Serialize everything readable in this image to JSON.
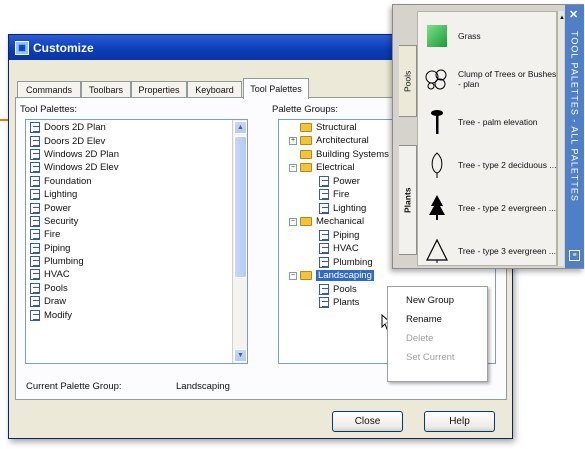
{
  "dialog": {
    "title": "Customize",
    "tabs": [
      "Commands",
      "Toolbars",
      "Properties",
      "Keyboard",
      "Tool Palettes"
    ],
    "active_tab": "Tool Palettes",
    "tool_palettes_label": "Tool Palettes:",
    "tool_palettes": [
      "Doors 2D Plan",
      "Doors 2D Elev",
      "Windows 2D Plan",
      "Windows 2D Elev",
      "Foundation",
      "Lighting",
      "Power",
      "Security",
      "Fire",
      "Piping",
      "Plumbing",
      "HVAC",
      "Pools",
      "Draw",
      "Modify"
    ],
    "palette_groups_label": "Palette Groups:",
    "groups": {
      "structural": "Structural",
      "architectural": "Architectural",
      "building_systems": "Building Systems",
      "electrical": "Electrical",
      "power": "Power",
      "fire": "Fire",
      "lighting": "Lighting",
      "mechanical": "Mechanical",
      "piping": "Piping",
      "hvac": "HVAC",
      "plumbing": "Plumbing",
      "landscaping": "Landscaping",
      "pools": "Pools",
      "plants": "Plants"
    },
    "current_group_label": "Current Palette Group:",
    "current_group_value": "Landscaping",
    "close_label": "Close",
    "help_label": "Help"
  },
  "context_menu": {
    "new_group": "New Group",
    "rename": "Rename",
    "delete": "Delete",
    "set_current": "Set Current"
  },
  "palette_window": {
    "side_title": "TOOL PALETTES - ALL PALETTES",
    "tab_pools": "Pools",
    "tab_plants": "Plants",
    "items": [
      {
        "label": "Grass",
        "icon": "grass-swatch-icon"
      },
      {
        "label": "Clump of Trees or Bushes - plan",
        "icon": "tree-clump-icon"
      },
      {
        "label": "Tree - palm elevation",
        "icon": "palm-tree-icon"
      },
      {
        "label": "Tree - type 2 deciduous ...",
        "icon": "deciduous-tree-icon"
      },
      {
        "label": "Tree - type 2 evergreen ...",
        "icon": "evergreen-tree-icon"
      },
      {
        "label": "Tree - type 3 evergreen ...",
        "icon": "triangle-tree-icon"
      }
    ]
  },
  "colors": {
    "title_bar": "#0a3cb8",
    "selection": "#316ac5",
    "palette_side": "#4f7fc6",
    "callout_arrow": "#f07a10",
    "grass": "#2db84a"
  }
}
